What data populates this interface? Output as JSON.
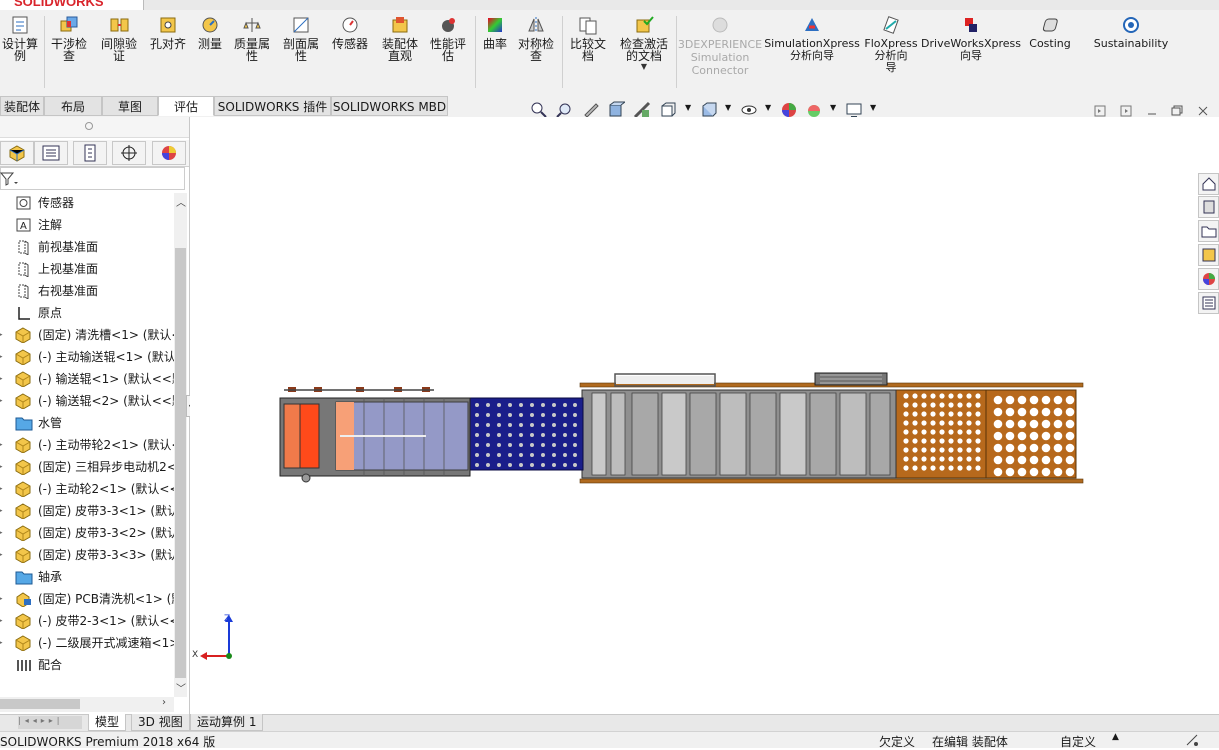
{
  "app": {
    "brand": "SOLIDWORKS"
  },
  "ribbon": {
    "items": [
      {
        "label": "设计算\n例",
        "icon": "design-study-icon"
      },
      {
        "label": "干涉检\n查",
        "icon": "interference-check-icon"
      },
      {
        "label": "间隙验\n证",
        "icon": "clearance-verify-icon"
      },
      {
        "label": "孔对齐",
        "icon": "hole-align-icon"
      },
      {
        "label": "测量",
        "icon": "measure-icon"
      },
      {
        "label": "质量属\n性",
        "icon": "mass-properties-icon"
      },
      {
        "label": "剖面属\n性",
        "icon": "section-properties-icon"
      },
      {
        "label": "传感器",
        "icon": "sensor-icon"
      },
      {
        "label": "装配体\n直观",
        "icon": "assembly-visualization-icon"
      },
      {
        "label": "性能评\n估",
        "icon": "performance-evaluation-icon"
      },
      {
        "label": "曲率",
        "icon": "curvature-icon"
      },
      {
        "label": "对称检\n查",
        "icon": "symmetry-check-icon"
      },
      {
        "label": "比较文\n档",
        "icon": "compare-documents-icon"
      },
      {
        "label": "检查激活\n的文档",
        "icon": "check-active-document-icon"
      },
      {
        "label": "3DEXPERIENCE\nSimulation\nConnector",
        "icon": "3dexperience-icon"
      },
      {
        "label": "SimulationXpress\n分析向导",
        "icon": "simulationxpress-icon"
      },
      {
        "label": "FloXpress\n分析向\n导",
        "icon": "floxpress-icon"
      },
      {
        "label": "DriveWorksXpress\n向导",
        "icon": "driveworksxpress-icon"
      },
      {
        "label": "Costing",
        "icon": "costing-icon"
      },
      {
        "label": "Sustainability",
        "icon": "sustainability-icon"
      }
    ]
  },
  "tabs": [
    "装配体",
    "布局",
    "草图",
    "评估",
    "SOLIDWORKS 插件",
    "SOLIDWORKS MBD"
  ],
  "active_tab": "评估",
  "tree": {
    "items": [
      {
        "label": "传感器",
        "icon": "sensor-folder-icon"
      },
      {
        "label": "注解",
        "icon": "annotation-icon"
      },
      {
        "label": "前视基准面",
        "icon": "plane-icon"
      },
      {
        "label": "上视基准面",
        "icon": "plane-icon"
      },
      {
        "label": "右视基准面",
        "icon": "plane-icon"
      },
      {
        "label": "原点",
        "icon": "origin-icon"
      },
      {
        "label": "(固定) 清洗槽<1> (默认<",
        "icon": "part-icon"
      },
      {
        "label": "(-) 主动输送辊<1> (默认",
        "icon": "part-icon"
      },
      {
        "label": "(-) 输送辊<1> (默认<<默",
        "icon": "part-icon"
      },
      {
        "label": "(-) 输送辊<2> (默认<<默",
        "icon": "part-icon"
      },
      {
        "label": "水管",
        "icon": "folder-icon"
      },
      {
        "label": "(-) 主动带轮2<1> (默认<",
        "icon": "part-icon"
      },
      {
        "label": "(固定) 三相异步电动机2<",
        "icon": "part-icon"
      },
      {
        "label": "(-) 主动轮2<1> (默认<<",
        "icon": "part-icon"
      },
      {
        "label": "(固定) 皮带3-3<1> (默认",
        "icon": "part-icon"
      },
      {
        "label": "(固定) 皮带3-3<2> (默认",
        "icon": "part-icon"
      },
      {
        "label": "(固定) 皮带3-3<3> (默认",
        "icon": "part-icon"
      },
      {
        "label": "轴承",
        "icon": "folder-icon"
      },
      {
        "label": "(固定) PCB清洗机<1> (默",
        "icon": "subassembly-icon"
      },
      {
        "label": "(-) 皮带2-3<1> (默认<<",
        "icon": "part-icon"
      },
      {
        "label": "(-) 二级展开式减速箱<1>",
        "icon": "part-icon"
      },
      {
        "label": "配合",
        "icon": "mates-icon"
      }
    ]
  },
  "triad": {
    "z": "Z",
    "x": "X"
  },
  "bottom_tabs": [
    "模型",
    "3D 视图",
    "运动算例 1"
  ],
  "status": {
    "product": "SOLIDWORKS Premium 2018 x64 版",
    "defined": "欠定义",
    "editing": "在编辑 装配体",
    "units": "自定义"
  }
}
